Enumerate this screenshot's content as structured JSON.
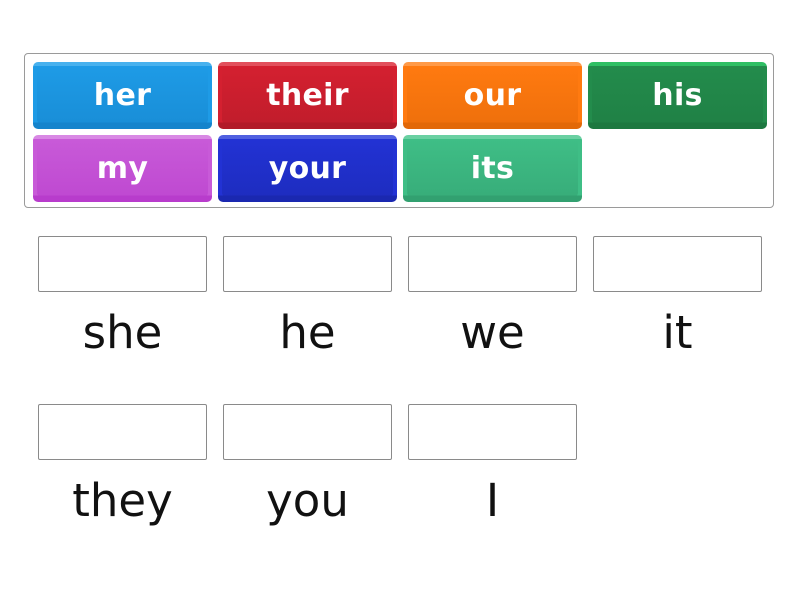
{
  "tiles": [
    {
      "label": "her",
      "color": "#1e9be6",
      "light": "#48b1ee",
      "dark": "#1584cc"
    },
    {
      "label": "their",
      "color": "#d42030",
      "light": "#e2505c",
      "dark": "#b21a28"
    },
    {
      "label": "our",
      "color": "#ff7a10",
      "light": "#ff9a48",
      "dark": "#e26808"
    },
    {
      "label": "his",
      "color": "#238c4c",
      "light": "#2fbf64",
      "dark": "#1d7840"
    },
    {
      "label": "my",
      "color": "#c85ad8",
      "light": "#d889e4",
      "dark": "#b83ccc"
    },
    {
      "label": "your",
      "color": "#2232d4",
      "light": "#5060e0",
      "dark": "#1a28b0"
    },
    {
      "label": "its",
      "color": "#3fbe86",
      "light": "#6ad0a2",
      "dark": "#32a070"
    }
  ],
  "targets": [
    {
      "word": "she"
    },
    {
      "word": "he"
    },
    {
      "word": "we"
    },
    {
      "word": "it"
    },
    {
      "word": "they"
    },
    {
      "word": "you"
    },
    {
      "word": "I"
    }
  ]
}
